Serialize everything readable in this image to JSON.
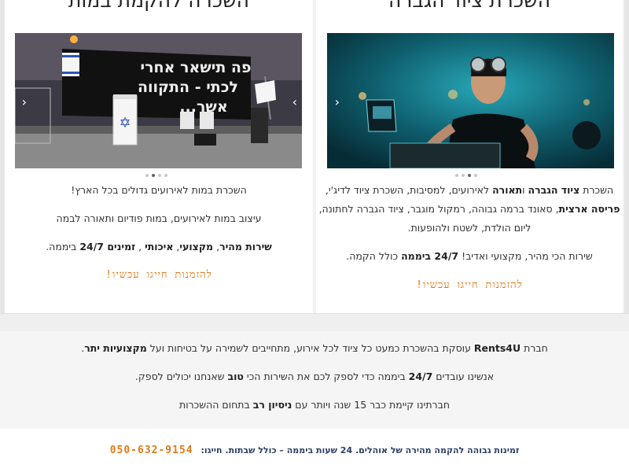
{
  "cards": {
    "right": {
      "title": "השכרת ציוד הגברה",
      "desc": {
        "l1a": "השכרת ",
        "l1b": "ציוד הגברה",
        "l1c": " ו",
        "l1d": "תאורה",
        "l1e": " לאירועים, למסיבות, השכרת ציוד לדיג'י,",
        "l2a": "פריסה ארצית",
        "l2b": ", סאונד ברמה גבוהה, רמקול מוגבר, ציוד הגברה לחתונה,",
        "l3": "ליום הולדת, לשטח ולהופעות.",
        "l4a": "שירות הכי מהיר, מקצועי ואדיב! ",
        "l4b": "24/7 ביממה",
        "l4c": " כולל הקמה."
      },
      "cta": "להזמנות חייגו עכשיו!"
    },
    "left": {
      "title": "השכרה להקמת במות",
      "desc": {
        "l1": "השכרת במות לאירועים גדולים בכל הארץ!",
        "l2": "עיצוב במות לאירועים, במות פודיום ותאורה לבמה",
        "l3a": "שירות מהיר",
        "l3b": ", ",
        "l3c": "מקצועי",
        "l3d": ", ",
        "l3e": "איכותי",
        "l3f": " , ",
        "l3g": "זמינים 24/7",
        "l3h": " ביממה."
      },
      "cta": "להזמנות חייגו עכשיו!"
    }
  },
  "stage_banner": {
    "line1": "פה תישאר אחרי",
    "line2": "לכתי - התקווה",
    "line3": "אשר..."
  },
  "about": {
    "p1a": "חברת ",
    "p1b": "Rents4U",
    "p1c": " עוסקת בהשכרת כמעט כל ציוד לכל אירוע, מתחייבים לשמירה על בטיחות ועל ",
    "p1d": "מקצועיות יתר",
    "p1e": ".",
    "p2a": "אנשינו עובדים ",
    "p2b": "24/7",
    "p2c": " ביממה כדי לספק לכם את השירות הכי ",
    "p2d": "טוב",
    "p2e": " שאנחנו יכולים לספק.",
    "p3a": "חברתינו קיימת כבר 15 שנה ויותר עם ",
    "p3b": "ניסיון רב",
    "p3c": " בתחום ההשכרות"
  },
  "footer": {
    "text": "זמינות גבוהה להקמה מהירה של אוהלים. 24 שעות ביממה – כולל שבתות. חייגו:",
    "phone": "050-632-9154"
  },
  "colors": {
    "accent": "#e07a1a",
    "footer_text": "#2a3f63"
  },
  "icons": {
    "prev": "chevron-left-icon",
    "next": "chevron-right-icon"
  }
}
